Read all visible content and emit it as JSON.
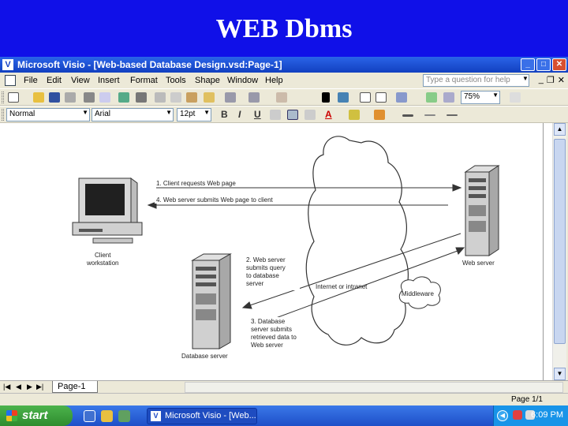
{
  "slide": {
    "title": "WEB Dbms"
  },
  "window": {
    "title": "Microsoft Visio - [Web-based Database Design.vsd:Page-1]",
    "app_icon": "visio-icon"
  },
  "menu": {
    "items": [
      "File",
      "Edit",
      "View",
      "Insert",
      "Format",
      "Tools",
      "Shape",
      "Window",
      "Help"
    ],
    "help_placeholder": "Type a question for help"
  },
  "toolbar": {
    "zoom": "75%",
    "style": "Normal",
    "font": "Arial",
    "font_size": "12pt"
  },
  "diagram": {
    "client_label_1": "Client",
    "client_label_2": "workstation",
    "web_server_label": "Web server",
    "db_server_label": "Database server",
    "cloud_label": "Internet or intranet",
    "middleware_label": "Middleware",
    "step1": "1. Client requests Web page",
    "step4": "4. Web server submits Web page to client",
    "step2_lines": [
      "2. Web server",
      "submits query",
      "to database",
      "server"
    ],
    "step3_lines": [
      "3. Database",
      "server submits",
      "retrieved data to",
      "Web server"
    ]
  },
  "pages": {
    "tab_label": "Page-1",
    "status": "Page 1/1"
  },
  "taskbar": {
    "start_label": "start",
    "task_label": "Microsoft Visio - [Web...",
    "clock": "6:09 PM"
  }
}
